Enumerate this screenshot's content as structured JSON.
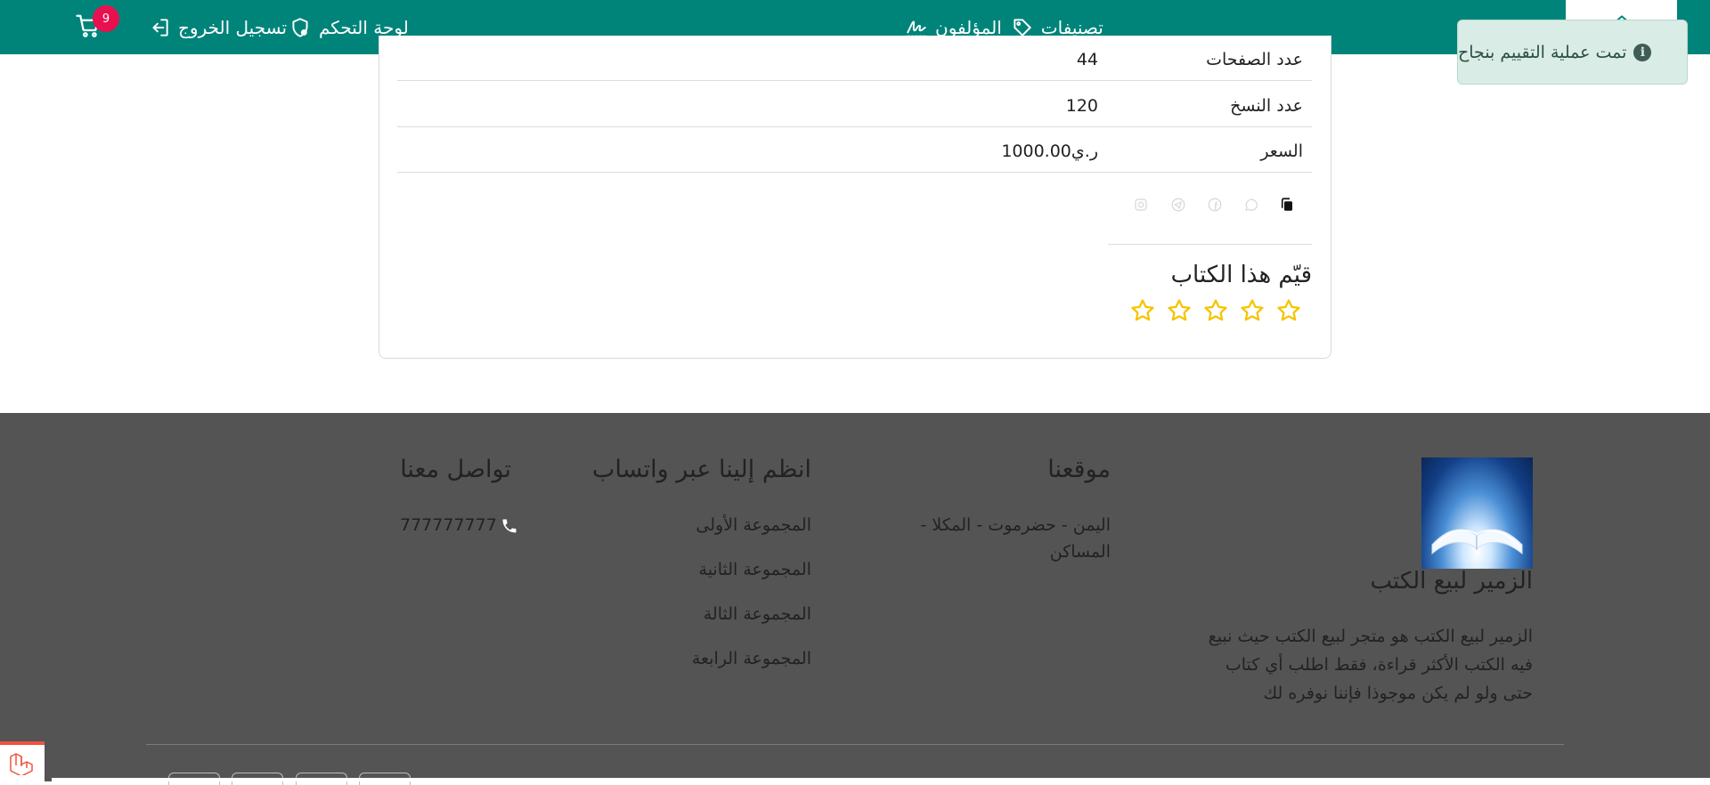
{
  "nav": {
    "logout": "تسجيل الخروج",
    "dashboard": "لوحة التحكم",
    "categories": "تصنيفات",
    "authors": "المؤلفون",
    "cart_count": "9"
  },
  "toast": {
    "message": "تمت عملية التقييم بنجاح"
  },
  "book": {
    "rows": [
      {
        "label": "عدد الصفحات",
        "value": "44"
      },
      {
        "label": "عدد النسخ",
        "value": "120"
      },
      {
        "label": "السعر",
        "value": "1000.00ر.ي"
      }
    ],
    "share_icons": [
      "copy-icon",
      "whatsapp-icon",
      "facebook-icon",
      "telegram-icon",
      "instagram-icon"
    ],
    "rating_title": "قيّم هذا الكتاب",
    "stars": 5,
    "star_color": "#f5c400"
  },
  "footer": {
    "brand_name": "الزمير لبيع الكتب",
    "about_lines": [
      "الزمير لبيع الكتب هو متجر لبيع الكتب حيث نبيع",
      "فيه الكتب الأكثر قراءة، فقط اطلب أي كتاب",
      "حتى ولو لم يكن موجوذا فإننا نوفره لك"
    ],
    "location_title": "موقعنا",
    "location_lines": [
      "اليمن - حضرموت - المكلا -",
      "المساكن"
    ],
    "whatsapp_title": "انظم إلينا عبر واتساب",
    "groups": [
      "المجموعة الأولى",
      "المجموعة الثانية",
      "المجموعة الثالة",
      "المجموعة الرابعة"
    ],
    "contact_title": "تواصل معنا",
    "phone": "777777777"
  },
  "colors": {
    "navbar": "#00847a",
    "footer": "#545454",
    "badge": "#e8104f",
    "toast_bg": "#d9ece5"
  }
}
